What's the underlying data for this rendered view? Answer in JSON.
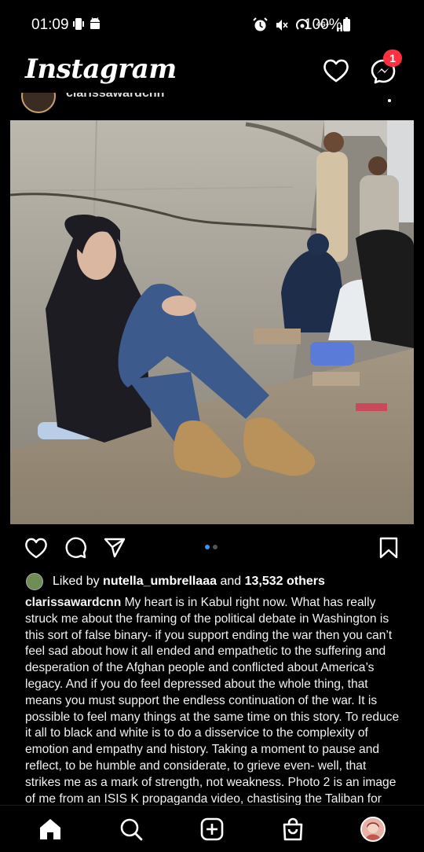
{
  "status_bar": {
    "time": "01:09",
    "network": "4G+",
    "battery": "100%"
  },
  "header": {
    "logo": "Instagram",
    "messenger_badge": "1"
  },
  "post": {
    "username": "clarissawardcnn",
    "liked_by_prefix": "Liked by",
    "liked_by_user": "nutella_umbrellaaa",
    "liked_by_middle": "and",
    "liked_by_others": "13,532 others",
    "caption_username": "clarissawardcnn",
    "caption_text": "My heart is in Kabul right now. What has really struck me about the framing of the political debate in Washington is this sort of false binary- if you support ending the war then you can’t feel sad about how it all ended and empathetic to the suffering and desperation of the Afghan people and conflicted about America’s legacy. And if you do feel depressed about the whole thing, that means you must support the endless continuation of the war. It is possible to feel many things at the same time on this story. To reduce it all to black and white is to do a disservice to the complexity of emotion and empathy and history. Taking a moment to pause and reflect, to be humble and considerate, to grieve even- well, that strikes me as a mark of strength, not weakness. Photo 2 is an image of me from an ISIS K propaganda video, chastising the Taliban for",
    "carousel": {
      "count": 2,
      "active": 0
    }
  },
  "icons": {
    "heart": "heart-icon",
    "messenger": "messenger-icon",
    "comment": "comment-icon",
    "share": "share-icon",
    "save": "bookmark-icon",
    "home": "home-icon",
    "search": "search-icon",
    "create": "create-icon",
    "shop": "shop-icon"
  },
  "colors": {
    "background": "#000000",
    "badge": "#ff3040",
    "carousel_active": "#3897f0"
  }
}
